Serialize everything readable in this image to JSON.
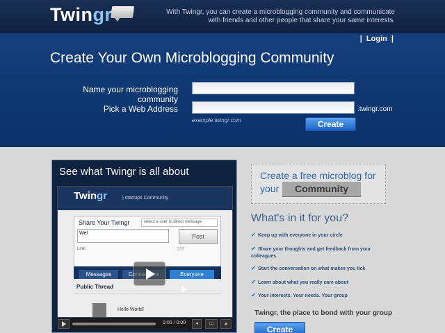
{
  "header": {
    "logo_main": "Twin",
    "logo_accent": "gr",
    "tagline": "With Twingr, you can create a microblogging community and communicate with friends and other people that share your same interests."
  },
  "nav": {
    "sep_left": "|",
    "login": "Login",
    "sep_right": "|"
  },
  "hero": {
    "title": "Create Your Own Microblogging Community",
    "name_label": "Name your microblogging community",
    "name_value": "",
    "address_label": "Pick a Web Address",
    "address_value": "",
    "domain_suffix": ".twingr.com",
    "example": "example.twingr.com",
    "create_label": "Create"
  },
  "video": {
    "title": "See what Twingr is all about",
    "logo_main": "Twin",
    "logo_accent": "gr",
    "community_label": "| startups Community",
    "share_title": "Share Your Twingr",
    "select_placeholder": "select a user to direct message",
    "message_text": "Wel",
    "post_label": "Post",
    "link_label": "Link:",
    "char_count": "137",
    "tabs": [
      "Messages",
      "Connections",
      "Everyone"
    ],
    "thread_title": "Public Thread",
    "thread_message": "Hello World!",
    "time_display": "0:00 / 0:00"
  },
  "promo": {
    "line1": "Create a free microblog for",
    "line2": "your",
    "badge": "Community"
  },
  "features": {
    "heading": "What's in it for you?",
    "items": [
      "Keep up with everyone in your circle",
      "Share your thoughts and get feedback from your colleagues",
      "Start the conversation on what makes you tick",
      "Learn about what you really care about",
      "Your interests. Your needs. Your group"
    ],
    "check_icon": "check-icon"
  },
  "footer": {
    "bond_text": "Twingr, the place to bond with your group",
    "create_label": "Create"
  },
  "colors": {
    "header_bg": "#0e2142",
    "hero_bg": "#0b3169",
    "accent_blue": "#2f66b3",
    "button_blue": "#1b63c6",
    "page_bg": "#d9d9d9"
  }
}
